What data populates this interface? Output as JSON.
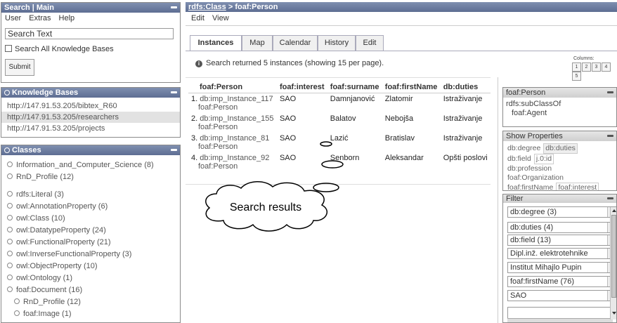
{
  "search_panel": {
    "title": "Search | Main",
    "menu": [
      "User",
      "Extras",
      "Help"
    ],
    "search_value": "Search Text",
    "checkbox_label": "Search All Knowledge Bases",
    "submit_label": "Submit"
  },
  "kb_panel": {
    "title": "Knowledge Bases",
    "items": [
      "http://147.91.53.205/bibtex_R60",
      "http://147.91.53.205/researchers",
      "http://147.91.53.205/projects"
    ]
  },
  "classes_panel": {
    "title": "Classes",
    "items": [
      "Information_and_Computer_Science (8)",
      "RnD_Profile (12)",
      "rdfs:Literal (3)",
      "owl:AnnotationProperty (6)",
      "owl:Class (10)",
      "owl:DatatypeProperty (24)",
      "owl:FunctionalProperty (21)",
      "owl:InverseFunctionalProperty (3)",
      "owl:ObjectProperty (10)",
      "owl:Ontology (1)",
      "foaf:Document (16)"
    ],
    "sub_items": [
      "RnD_Profile (12)",
      "foaf:Image (1)"
    ]
  },
  "main": {
    "breadcrumb_link": "rdfs:Class",
    "breadcrumb_sep": " > ",
    "breadcrumb_current": "foaf:Person",
    "menu": [
      "Edit",
      "View"
    ],
    "tabs": [
      "Instances",
      "Map",
      "Calendar",
      "History",
      "Edit"
    ],
    "info_text": "Search returned 5 instances (showing 15 per page).",
    "columns_label": "Columns:",
    "column_buttons": [
      "1",
      "2",
      "3",
      "4",
      "5"
    ],
    "table_headers": [
      "foaf:Person",
      "foaf:interest",
      "foaf:surname",
      "foaf:firstName",
      "db:duties"
    ],
    "rows": [
      {
        "num": "1.",
        "instance": "db:imp_Instance_117",
        "type": "foaf:Person",
        "interest": "SAO",
        "surname": "Damnjanović",
        "firstname": "Zlatomir",
        "duties": "Istraživanje"
      },
      {
        "num": "2.",
        "instance": "db:imp_Instance_155",
        "type": "foaf:Person",
        "interest": "SAO",
        "surname": "Balatov",
        "firstname": "Nebojša",
        "duties": "Istraživanje"
      },
      {
        "num": "3.",
        "instance": "db:imp_Instance_81",
        "type": "foaf:Person",
        "interest": "SAO",
        "surname": "Lazić",
        "firstname": "Bratislav",
        "duties": "Istraživanje"
      },
      {
        "num": "4.",
        "instance": "db:imp_Instance_92",
        "type": "foaf:Person",
        "interest": "SAO",
        "surname": "Senborn",
        "firstname": "Aleksandar",
        "duties": "Opšti poslovi"
      }
    ],
    "callout": "Search results"
  },
  "right_info": {
    "title": "foaf:Person",
    "line1": "rdfs:subClassOf",
    "line2": "foaf:Agent"
  },
  "show_props": {
    "title": "Show Properties",
    "rows": [
      [
        "db:degree",
        "db:duties"
      ],
      [
        "db:field",
        "j.0:id"
      ],
      [
        "db:profession"
      ],
      [
        "foaf:Organization"
      ],
      [
        "foaf:firstName",
        "foaf:interest"
      ]
    ]
  },
  "filter": {
    "title": "Filter",
    "selects": [
      "db:degree (3)",
      "db:duties (4)",
      "db:field (13)",
      "Dipl.inž. elektrotehnike",
      "Institut Mihajlo Pupin",
      "foaf:firstName (76)",
      "SAO"
    ]
  }
}
